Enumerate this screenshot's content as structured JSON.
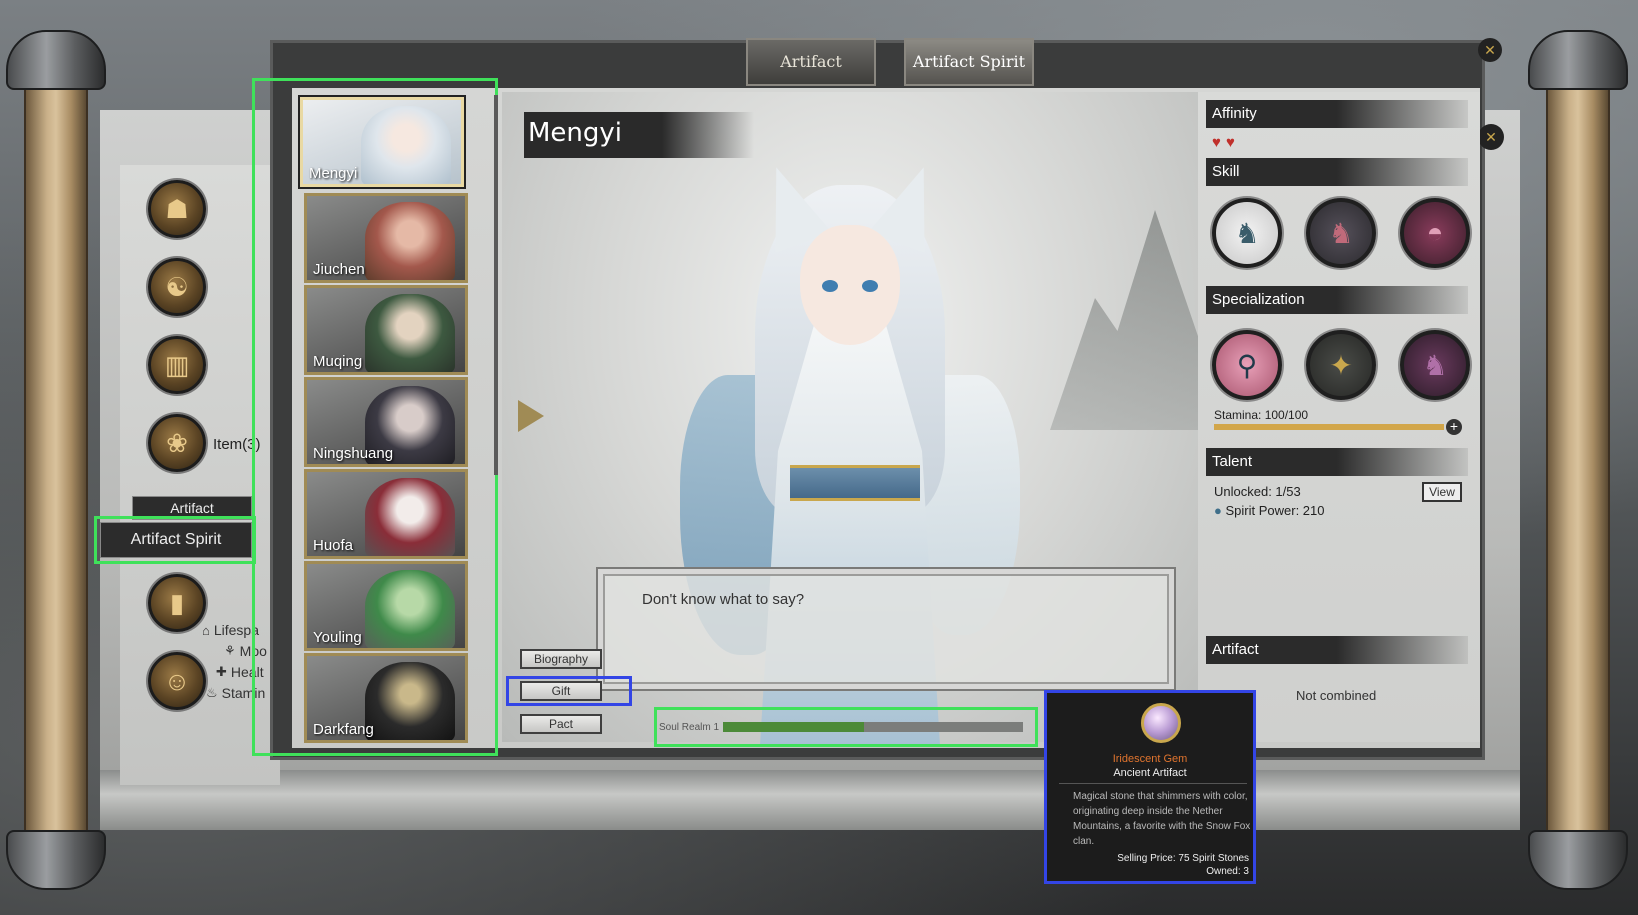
{
  "tabs": [
    {
      "label": "Artifact"
    },
    {
      "label": "Artifact Spirit"
    }
  ],
  "side_menu": {
    "item_label": "Item(3)",
    "artifact_button": "Artifact",
    "artifact_spirit_button": "Artifact Spirit",
    "stats": [
      "Lifespa",
      "Moo",
      "Healt",
      "Stamin"
    ]
  },
  "characters": [
    {
      "name": "Mengyi"
    },
    {
      "name": "Jiuchen"
    },
    {
      "name": "Muqing"
    },
    {
      "name": "Ningshuang"
    },
    {
      "name": "Huofa"
    },
    {
      "name": "Youling"
    },
    {
      "name": "Darkfang"
    }
  ],
  "selected": {
    "name": "Mengyi",
    "dialog": "Don't know what to say?"
  },
  "actions": {
    "biography": "Biography",
    "gift": "Gift",
    "pact": "Pact"
  },
  "soul_realm": {
    "label": "Soul Realm 1",
    "progress": 0.47
  },
  "right": {
    "affinity_head": "Affinity",
    "skill_head": "Skill",
    "specialization_head": "Specialization",
    "stamina": "Stamina: 100/100",
    "stamina_fraction": 1.0,
    "talent_head": "Talent",
    "unlocked": "Unlocked:  1/53",
    "view": "View",
    "spirit_power": "Spirit Power: 210",
    "artifact_head": "Artifact",
    "not_combined": "Not combined"
  },
  "tooltip": {
    "name": "Iridescent Gem",
    "type": "Ancient Artifact",
    "description": "Magical stone that shimmers with color, originating deep inside the Nether Mountains, a favorite with the Snow Fox clan.",
    "price": "Selling Price: 75 Spirit Stones",
    "owned": "Owned: 3"
  },
  "colors": {
    "highlight_green": "#3fe15a",
    "highlight_blue": "#3345e6",
    "heart_red": "#c0302b",
    "gem_name_orange": "#e0742e"
  }
}
